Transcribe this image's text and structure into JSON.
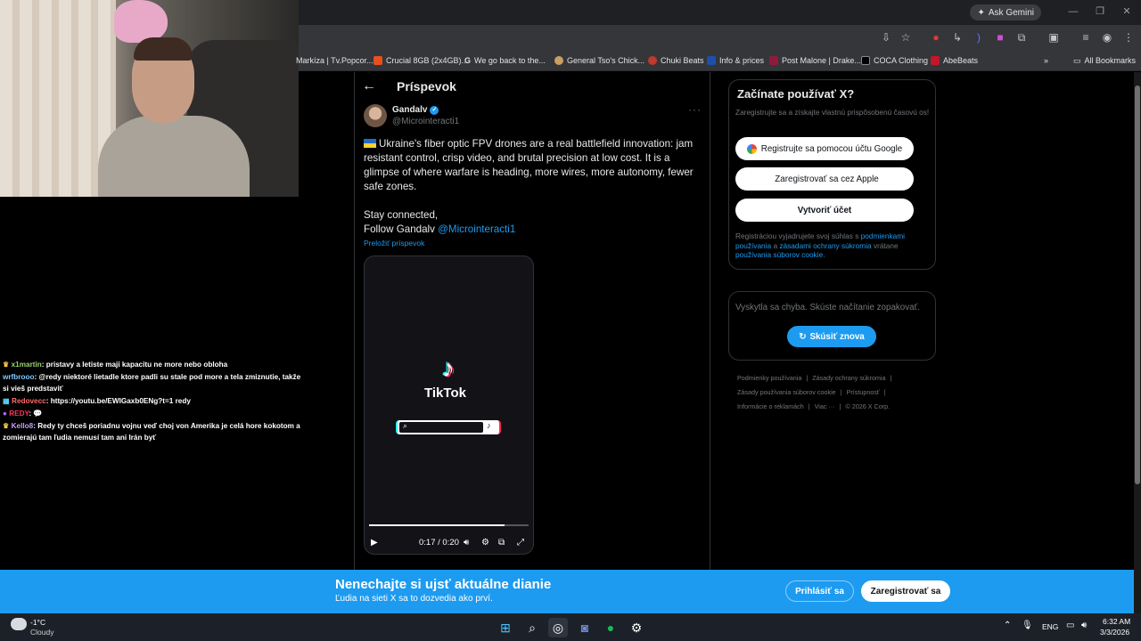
{
  "browser": {
    "ask_gemini": "Ask Gemini",
    "bookmarks": [
      {
        "label": "Markíza | Tv.Popcor...",
        "color": "#333333"
      },
      {
        "label": "Crucial 8GB (2x4GB)...",
        "color": "#e8501f"
      },
      {
        "label": "We go back to the...",
        "color": "#ffffff"
      },
      {
        "label": "General Tso's Chick...",
        "color": "#c8a060"
      },
      {
        "label": "Chuki Beats",
        "color": "#c0392b"
      },
      {
        "label": "Info & prices",
        "color": "#1f4fa8"
      },
      {
        "label": "Post Malone | Drake...",
        "color": "#8e1b3a"
      },
      {
        "label": "COCA Clothing",
        "color": "#222222"
      },
      {
        "label": "AbeBeats",
        "color": "#c4162a"
      }
    ],
    "all_bookmarks": "All Bookmarks"
  },
  "chat": {
    "messages": [
      {
        "user": "x1martin",
        "color": "#9bd36b",
        "badge": "👑",
        "text": ": pristavy a letiste maji kapacitu ne more nebo obloha"
      },
      {
        "user": "wrfbrooo",
        "color": "#7ec8ff",
        "badge": "",
        "text": ": @redy niektoré lietadle ktore padli su stale pod more a tela zmiznutie, takže si vieš predstaviť"
      },
      {
        "user": "Redovecc",
        "color": "#ff6a6a",
        "badge": "🎬",
        "text": ": https://youtu.be/EWIGaxb0ENg?t=1 redy"
      },
      {
        "user": "REDY",
        "color": "#ff3355",
        "badge": "🟣",
        "text": ": 💬"
      },
      {
        "user": "Kello8",
        "color": "#c79cff",
        "badge": "👑",
        "text": ": Redy ty chceš poriadnu vojnu veď choj von Amerika je celá hore kokotom a zomierajú tam ľudia nemusí tam ani Irán byť"
      }
    ]
  },
  "post": {
    "page_title": "Príspevok",
    "author_name": "Gandalv",
    "author_handle": "@Microinteracti1",
    "text": "Ukraine's fiber optic FPV drones are a real battlefield innovation: jam resistant control, crisp video, and brutal precision at low cost. It is a glimpse of where warfare is heading, more wires, more autonomy, fewer safe zones.",
    "stay_connected": "Stay connected,",
    "follow_prefix": "Follow Gandalv ",
    "follow_mention": "@Microinteracti1",
    "translate": "Preložiť príspevok",
    "video": {
      "brand": "TikTok",
      "time": "0:17 / 0:20",
      "progress": 0.85
    }
  },
  "sidebar": {
    "signup_title": "Začínate používať X?",
    "signup_sub": "Zaregistrujte sa a získajte vlastnú prispôsobenú časovú os!",
    "google_button": "Registrujte sa pomocou účtu Google",
    "apple_button": "Zaregistrovať sa cez Apple",
    "create_button": "Vytvoriť účet",
    "terms_prefix": "Registráciou vyjadrujete svoj súhlas s ",
    "terms_link1": "podmienkami používania",
    "terms_mid": " a ",
    "terms_link2": "zásadami ochrany súkromia",
    "terms_mid2": " vrátane ",
    "terms_link3": "používania súborov cookie",
    "terms_end": ".",
    "error_text": "Vyskytla sa chyba. Skúste načítanie zopakovať.",
    "retry_button": "Skúsiť znova",
    "footer": [
      "Podmienky používania",
      "|",
      "Zásady ochrany súkromia",
      "|",
      "Zásady používania súborov cookie",
      "|",
      "Prístupnosť",
      "|",
      "Informácie o reklamách",
      "|",
      "Viac ···",
      "© 2026 X Corp."
    ]
  },
  "banner": {
    "title": "Nenechajte si ujsť aktuálne dianie",
    "subtitle": "Ľudia na sieti X sa to dozvedia ako prví.",
    "login": "Prihlásiť sa",
    "signup": "Zaregistrovať sa"
  },
  "taskbar": {
    "temp": "-1°C",
    "condition": "Cloudy",
    "lang": "ENG",
    "time": "6:32 AM",
    "date": "3/3/2026"
  }
}
